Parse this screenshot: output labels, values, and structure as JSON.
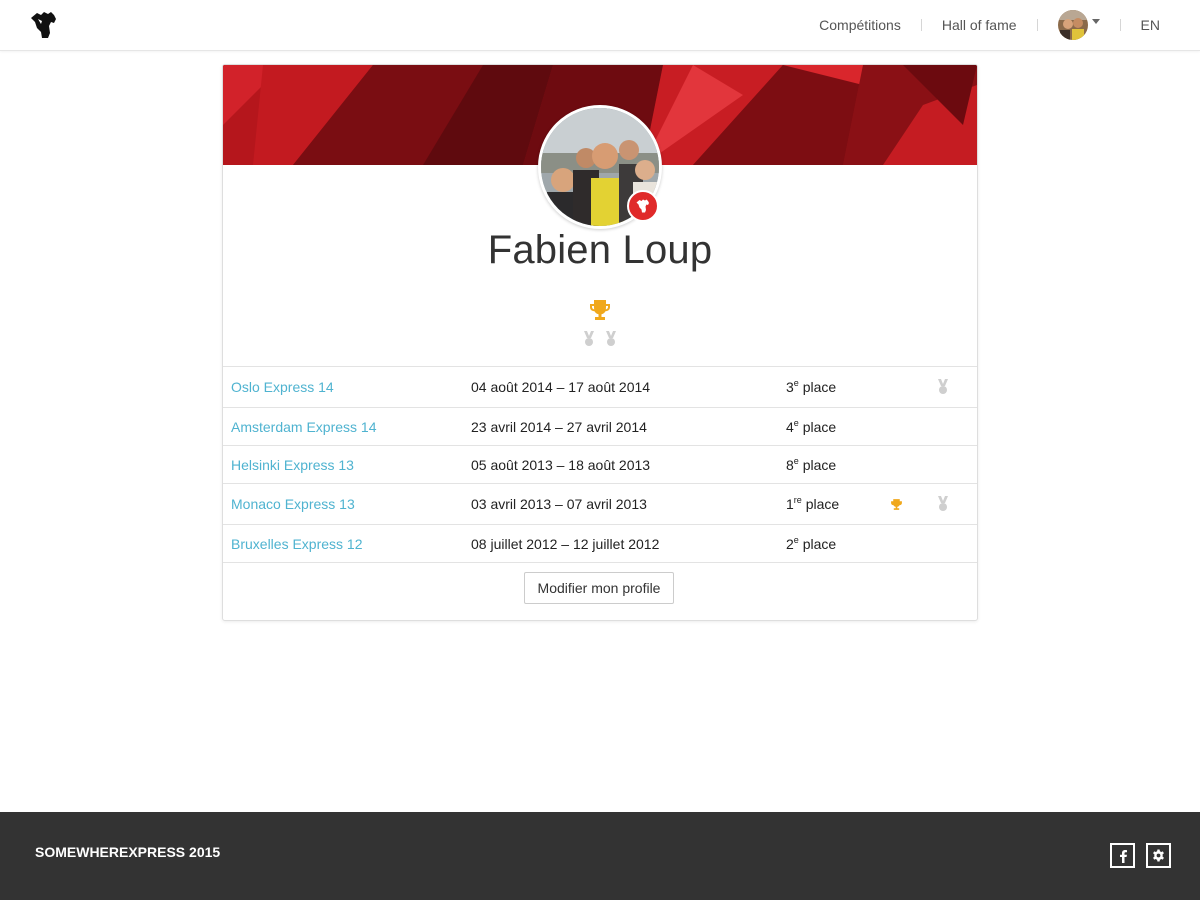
{
  "nav": {
    "links": [
      "Compétitions",
      "Hall of fame"
    ],
    "lang": "EN",
    "logo_icon": "raised-fist-icon",
    "avatar_icon": "user-avatar-icon"
  },
  "profile": {
    "name": "Fabien Loup",
    "badge_icon": "raised-fist-icon",
    "accent_color": "#e02a2a",
    "summary": {
      "trophies": 1,
      "medals": 2
    }
  },
  "results": {
    "rows": [
      {
        "competition": "Oslo Express 14",
        "dates": "04 août 2014 – 17 août 2014",
        "place_num": "3",
        "place_sup": "e",
        "place_word": "place",
        "trophy": false,
        "medal": true
      },
      {
        "competition": "Amsterdam Express 14",
        "dates": "23 avril 2014 – 27 avril 2014",
        "place_num": "4",
        "place_sup": "e",
        "place_word": "place",
        "trophy": false,
        "medal": false
      },
      {
        "competition": "Helsinki Express 13",
        "dates": "05 août 2013 – 18 août 2013",
        "place_num": "8",
        "place_sup": "e",
        "place_word": "place",
        "trophy": false,
        "medal": false
      },
      {
        "competition": "Monaco Express 13",
        "dates": "03 avril 2013 – 07 avril 2013",
        "place_num": "1",
        "place_sup": "re",
        "place_word": "place",
        "trophy": true,
        "medal": true
      },
      {
        "competition": "Bruxelles Express 12",
        "dates": "08 juillet 2012 – 12 juillet 2012",
        "place_num": "2",
        "place_sup": "e",
        "place_word": "place",
        "trophy": false,
        "medal": false
      }
    ],
    "link_color": "#4fb3d0",
    "trophy_color": "#f0a81c",
    "medal_color": "#c8c8c8"
  },
  "actions": {
    "edit_label": "Modifier mon profile"
  },
  "footer": {
    "copyright": "SOMEWHEREXPRESS 2015",
    "icons": [
      "facebook-icon",
      "gear-icon"
    ]
  }
}
